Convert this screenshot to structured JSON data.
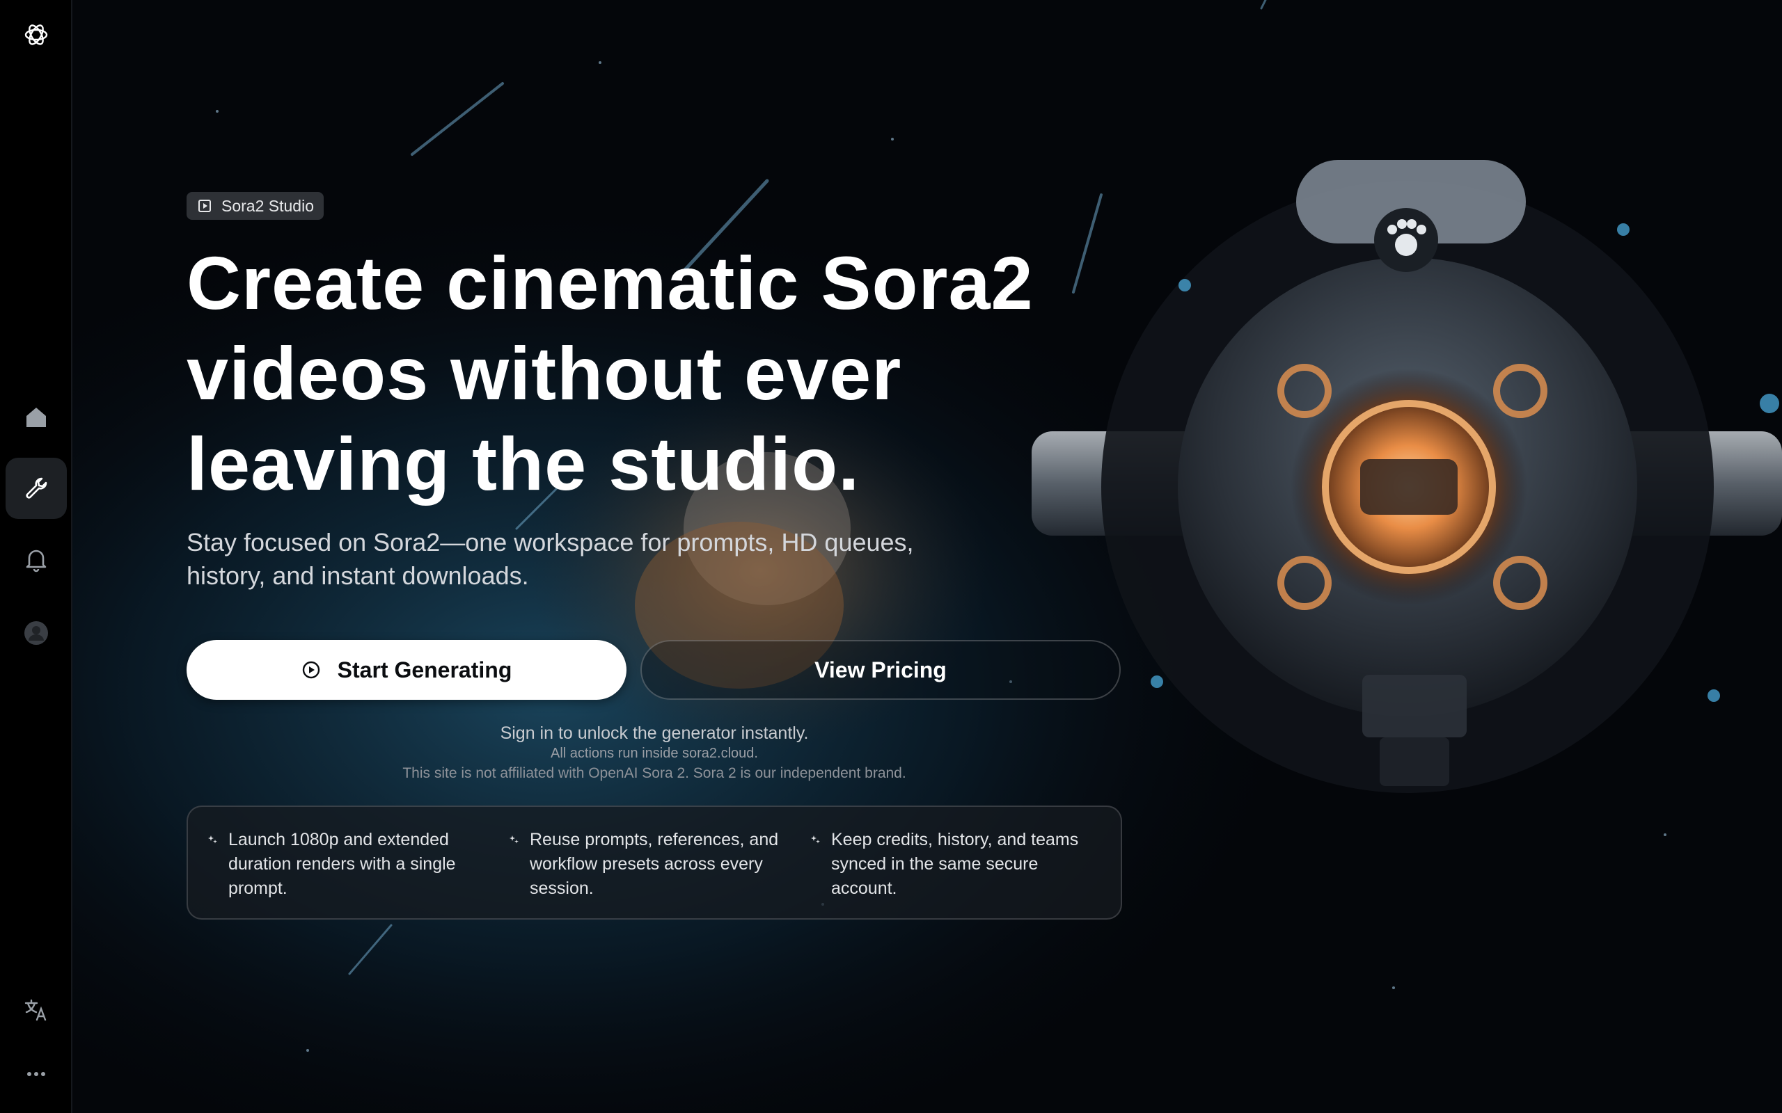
{
  "sidebar": {
    "logo_icon": "openai-logo-icon",
    "items": [
      {
        "name": "home",
        "icon": "home-icon",
        "active": false
      },
      {
        "name": "tools",
        "icon": "wrench-icon",
        "active": true
      },
      {
        "name": "notifications",
        "icon": "bell-icon",
        "active": false
      },
      {
        "name": "account",
        "icon": "user-avatar-icon",
        "active": false
      }
    ],
    "bottom": [
      {
        "name": "language",
        "icon": "translate-icon"
      },
      {
        "name": "more",
        "icon": "more-dots-icon"
      }
    ]
  },
  "hero": {
    "badge": "Sora2 Studio",
    "title_lines": [
      "Create cinematic Sora2",
      "videos without ever",
      "leaving the studio."
    ],
    "subtitle": "Stay focused on Sora2—one workspace for prompts, HD queues, history, and instant downloads.",
    "primary_cta": "Start Generating",
    "secondary_cta": "View Pricing",
    "note_signin": "Sign in to unlock the generator instantly.",
    "note_actions": "All actions run inside sora2.cloud.",
    "note_disclaimer": "This site is not affiliated with OpenAI Sora 2. Sora 2 is our independent brand."
  },
  "features": [
    {
      "text": "Launch 1080p and extended duration renders with a single prompt."
    },
    {
      "text": "Reuse prompts, references, and workflow presets across every session."
    },
    {
      "text": "Keep credits, history, and teams synced in the same secure account."
    }
  ],
  "colors": {
    "background": "#05070b",
    "sidebar": "#000000",
    "primary_button": "#ffffff",
    "accent_glow": "#f0a35a",
    "space_blue": "#1f4a63"
  }
}
